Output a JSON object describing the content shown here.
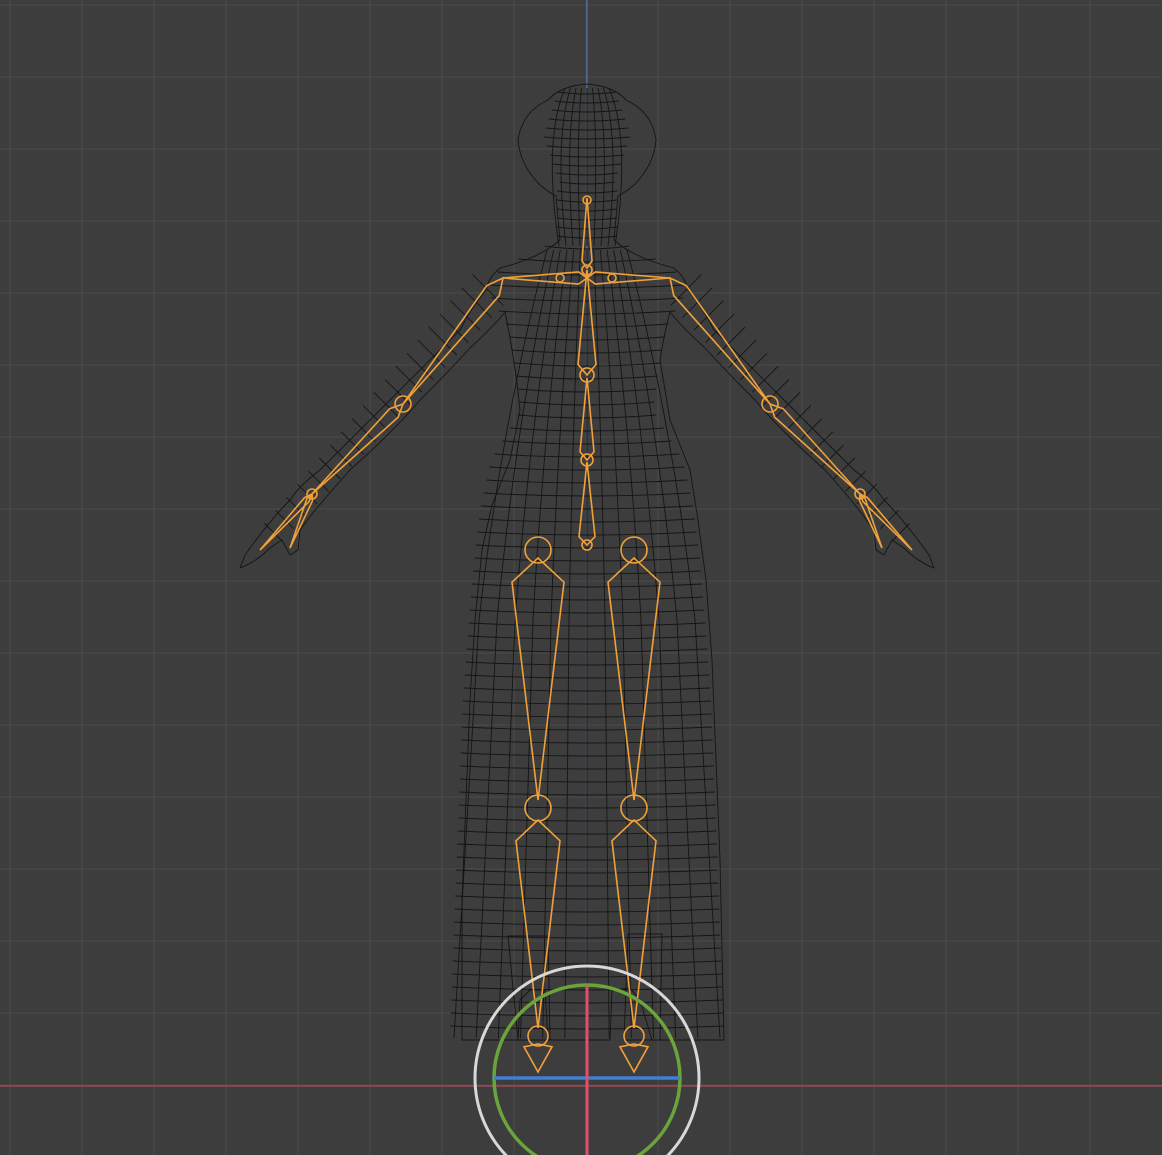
{
  "app": "3D viewport",
  "view": "front-orthographic",
  "display_mode": "wireframe",
  "scene": {
    "objects": [
      {
        "name": "character-mesh",
        "kind": "mesh"
      },
      {
        "name": "armature",
        "kind": "armature",
        "state": "selected"
      }
    ],
    "gizmos": [
      "transform-rotate-gizmo"
    ]
  },
  "colors": {
    "background": "#3d3d3d",
    "grid": "#4a4a4a",
    "x_axis": "#b3485a",
    "z_axis": "#4a78b3",
    "mesh_wire": "#151515",
    "bone": "#f0a13a",
    "gizmo_outer": "#d8d8d8",
    "gizmo_green": "#6aa43a",
    "gizmo_blue": "#3f7fd9"
  }
}
